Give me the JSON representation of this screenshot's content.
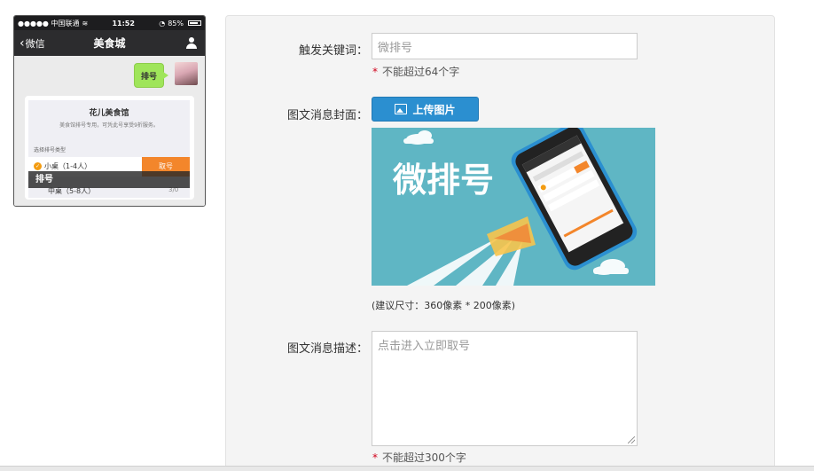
{
  "phone": {
    "status": {
      "carrier": "●●●●● 中国联通",
      "time": "11:52",
      "battery": "85%"
    },
    "nav": {
      "back_label": "微信",
      "title": "美食城"
    },
    "chat": {
      "bubble_text": "排号"
    },
    "card": {
      "shop_name": "花儿美食馆",
      "description": "美食馆排号专用，可凭此号享受9折服务。",
      "type_label": "选择排号类型",
      "row1_label": "小桌（1-4人）",
      "take_button": "取号",
      "row2_label": "中桌（5-8人）",
      "row2_count": "3/0",
      "overlay": "排号"
    }
  },
  "form": {
    "keyword_label": "触发关键词：",
    "keyword_value": "微排号",
    "keyword_hint": "不能超过64个字",
    "cover_label": "图文消息封面：",
    "upload_button": "上传图片",
    "cover_text": "微排号",
    "size_note": "(建议尺寸：360像素 * 200像素)",
    "desc_label": "图文消息描述：",
    "desc_value": "点击进入立即取号",
    "desc_hint": "不能超过300个字",
    "required_mark": "*"
  },
  "colors": {
    "upload_button": "#2b8fd0",
    "take_button": "#f3862b",
    "bubble": "#9fe55a",
    "cover_bg": "#5fb6c4",
    "required": "#d0021b"
  }
}
